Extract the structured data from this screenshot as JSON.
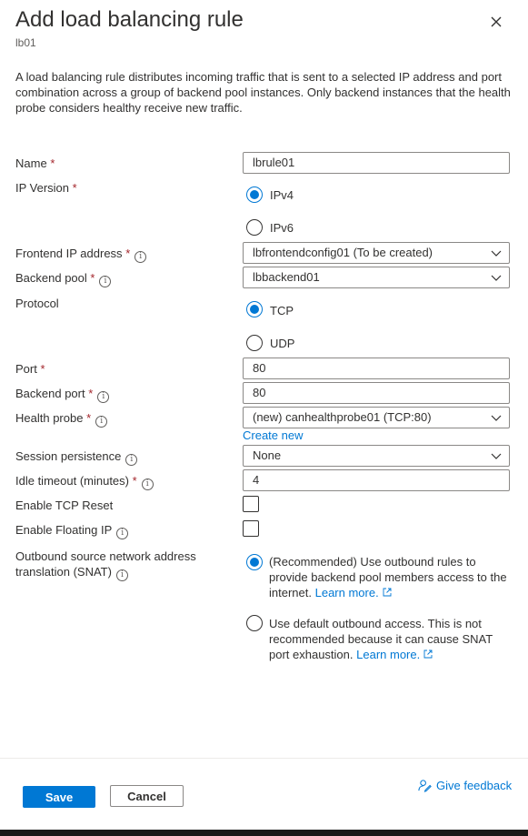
{
  "header": {
    "title": "Add load balancing rule",
    "subtitle": "lb01",
    "description": "A load balancing rule distributes incoming traffic that is sent to a selected IP address and port combination across a group of backend pool instances. Only backend instances that the health probe considers healthy receive new traffic."
  },
  "form": {
    "name": {
      "label": "Name",
      "required": "*",
      "value": "lbrule01"
    },
    "ip_version": {
      "label": "IP Version",
      "required": "*",
      "options": [
        {
          "label": "IPv4",
          "selected": true
        },
        {
          "label": "IPv6",
          "selected": false
        }
      ]
    },
    "frontend_ip": {
      "label": "Frontend IP address",
      "required": "*",
      "value": "lbfrontendconfig01 (To be created)"
    },
    "backend_pool": {
      "label": "Backend pool",
      "required": "*",
      "value": "lbbackend01"
    },
    "protocol": {
      "label": "Protocol",
      "options": [
        {
          "label": "TCP",
          "selected": true
        },
        {
          "label": "UDP",
          "selected": false
        }
      ]
    },
    "port": {
      "label": "Port",
      "required": "*",
      "value": "80"
    },
    "backend_port": {
      "label": "Backend port",
      "required": "*",
      "value": "80"
    },
    "health_probe": {
      "label": "Health probe",
      "required": "*",
      "value": "(new) canhealthprobe01 (TCP:80)",
      "create_new": "Create new"
    },
    "session_persistence": {
      "label": "Session persistence",
      "value": "None"
    },
    "idle_timeout": {
      "label": "Idle timeout (minutes)",
      "required": "*",
      "value": "4"
    },
    "tcp_reset": {
      "label": "Enable TCP Reset",
      "checked": false
    },
    "floating_ip": {
      "label": "Enable Floating IP",
      "checked": false
    },
    "snat": {
      "label_line1": "Outbound source network address",
      "label_line2": "translation (SNAT)",
      "options": [
        {
          "text": "(Recommended) Use outbound rules to provide backend pool members access to the internet.",
          "link": "Learn more.",
          "selected": true
        },
        {
          "text": "Use default outbound access. This is not recommended because it can cause SNAT port exhaustion.",
          "link": "Learn more.",
          "selected": false
        }
      ]
    }
  },
  "footer": {
    "save_label": "Save",
    "cancel_label": "Cancel",
    "feedback_label": "Give feedback"
  },
  "colors": {
    "accent": "#0078d4",
    "required": "#a4262c",
    "text": "#323130",
    "border": "#8a8886"
  },
  "icons": [
    "close-icon",
    "info-icon",
    "chevron-down-icon",
    "external-link-icon",
    "feedback-icon"
  ]
}
